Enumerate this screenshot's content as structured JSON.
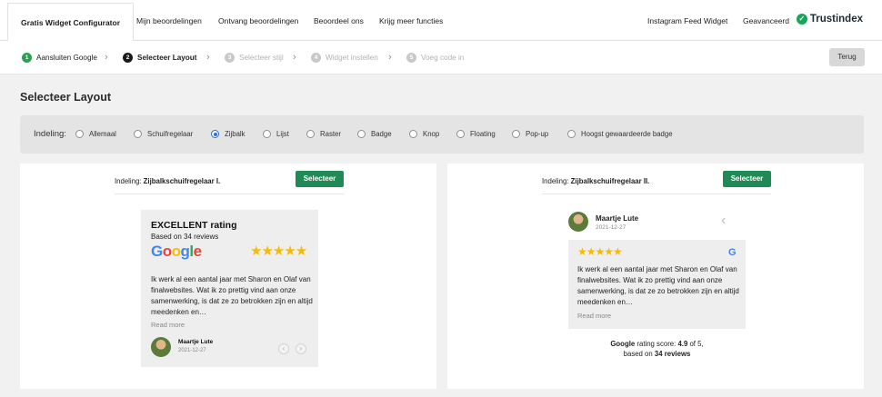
{
  "nav": {
    "tabs": [
      {
        "label": "Gratis Widget Configurator",
        "active": true
      },
      {
        "label": "Mijn beoordelingen"
      },
      {
        "label": "Ontvang beoordelingen"
      },
      {
        "label": "Beoordeel ons"
      },
      {
        "label": "Krijg meer functies"
      }
    ],
    "right_tabs": [
      {
        "label": "Instagram Feed Widget"
      },
      {
        "label": "Geavanceerd"
      }
    ],
    "brand": "Trustindex",
    "brand_color": "#17a55a"
  },
  "steps": {
    "items": [
      {
        "num": "1",
        "label": "Aansluiten Google",
        "state": "done"
      },
      {
        "num": "2",
        "label": "Selecteer Layout",
        "state": "current"
      },
      {
        "num": "3",
        "label": "Selecteer stijl",
        "state": "disabled"
      },
      {
        "num": "4",
        "label": "Widget instellen",
        "state": "disabled"
      },
      {
        "num": "5",
        "label": "Voeg code in",
        "state": "disabled"
      }
    ],
    "back_label": "Terug"
  },
  "page_title": "Selecteer Layout",
  "filter": {
    "label": "Indeling:",
    "options": [
      {
        "label": "Allemaal"
      },
      {
        "label": "Schuifregelaar"
      },
      {
        "label": "Zijbalk",
        "selected": true
      },
      {
        "label": "Lijst"
      },
      {
        "label": "Raster"
      },
      {
        "label": "Badge"
      },
      {
        "label": "Knop"
      },
      {
        "label": "Floating"
      },
      {
        "label": "Pop-up"
      },
      {
        "label": "Hoogst gewaardeerde badge"
      }
    ]
  },
  "cards": [
    {
      "prefix": "Indeling:",
      "layout_name": "Zijbalkschuifregelaar I.",
      "select_label": "Selecteer",
      "widget": {
        "title": "EXCELLENT rating",
        "subtitle": "Based on 34 reviews",
        "stars": "★★★★★",
        "text": "Ik werk al een aantal jaar met Sharon en Olaf van finalwebsites. Wat ik zo prettig vind aan onze samenwerking, is dat ze zo betrokken zijn en altijd meedenken en…",
        "read_more": "Read more",
        "reviewer": "Maartje Lute",
        "date": "2021-12-27"
      }
    },
    {
      "prefix": "Indeling:",
      "layout_name": "Zijbalkschuifregelaar II.",
      "select_label": "Selecteer",
      "widget": {
        "reviewer": "Maartje Lute",
        "date": "2021-12-27",
        "stars": "★★★★★",
        "text": "Ik werk al een aantal jaar met Sharon en Olaf van finalwebsites. Wat ik zo prettig vind aan onze samenwerking, is dat ze zo betrokken zijn en altijd meedenken en…",
        "read_more": "Read more",
        "score_platform": "Google",
        "score_mid": " rating score: ",
        "score_value": "4.9",
        "score_of": " of 5,",
        "based_on": "based on ",
        "reviews": "34 reviews"
      }
    }
  ],
  "colors": {
    "select_button": "#1f8a55",
    "star": "#f6bb06",
    "radio_selected": "#2a6fd6"
  }
}
